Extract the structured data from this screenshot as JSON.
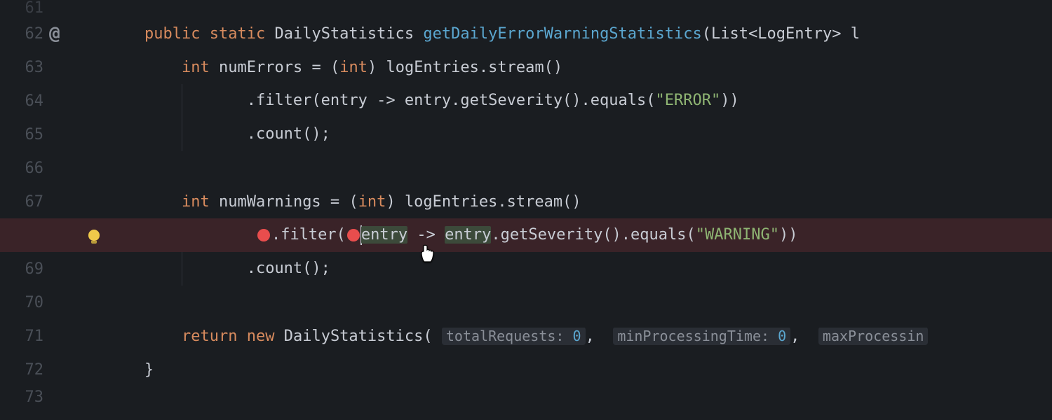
{
  "lines": {
    "l61": "61",
    "l62": "62",
    "l63": "63",
    "l64": "64",
    "l65": "65",
    "l66": "66",
    "l67": "67",
    "l68": "",
    "l69": "69",
    "l70": "70",
    "l71": "71",
    "l72": "72",
    "l73": "73"
  },
  "tokens": {
    "public": "public",
    "static": "static",
    "DailyStatistics": "DailyStatistics",
    "methodName": "getDailyErrorWarningStatistics",
    "sigTail": "(List<LogEntry> l",
    "int": "int",
    "numErrors": "numErrors",
    "cast": "(int)",
    "logEntriesStream": "logEntries.stream()",
    "filter": ".filter(",
    "entry": "entry",
    "arrow": " -> ",
    "entryGet": "entry.getSeverity().equals(",
    "errorStr": "\"ERROR\"",
    "warnStr": "\"WARNING\"",
    "closeParens": "))",
    "count": ".count();",
    "numWarnings": "numWarnings",
    "return": "return",
    "new": "new",
    "ctorOpen": "DailyStatistics(",
    "hint1": "totalRequests:",
    "hint2": "minProcessingTime:",
    "hint3": "maxProcessin",
    "zero": "0",
    "comma": ",",
    "eq": " = ",
    "closeBrace": "}",
    "atSign": "@"
  }
}
